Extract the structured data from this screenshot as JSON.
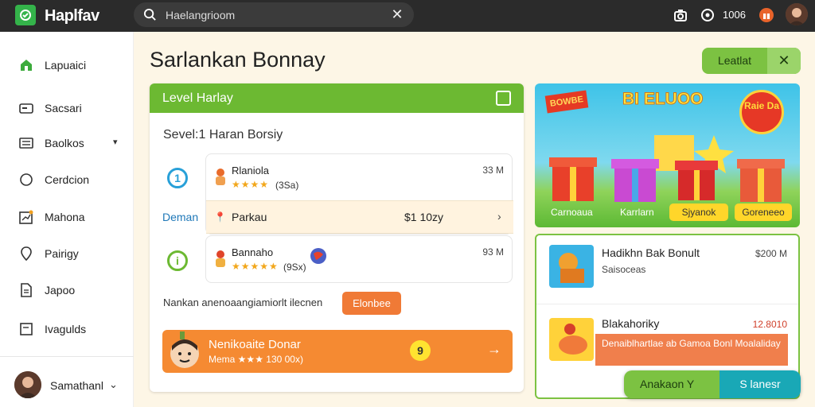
{
  "app": {
    "title": "Haplfav"
  },
  "search": {
    "value": "Haelangrioom",
    "clear_icon": "close-icon"
  },
  "topbar": {
    "count": "1006"
  },
  "sidebar": {
    "items": [
      {
        "label": "Lapuaici",
        "icon": "home-icon",
        "active": true
      },
      {
        "label": "Sacsari",
        "icon": "card-icon"
      },
      {
        "label": "Baolkos",
        "icon": "list-icon",
        "has_submenu": true
      },
      {
        "label": "Cerdcion",
        "icon": "circle-icon"
      },
      {
        "label": "Mahona",
        "icon": "chart-icon"
      },
      {
        "label": "Pairigy",
        "icon": "pin-icon"
      },
      {
        "label": "Japoo",
        "icon": "document-icon"
      },
      {
        "label": "Ivagulds",
        "icon": "box-icon"
      }
    ],
    "user": {
      "name": "Samathanl"
    }
  },
  "main": {
    "title": "Sarlankan Bonnay",
    "top_action_label": "Leatlat",
    "panel": {
      "title": "Level Harlay",
      "subtitle": "Sevel:1 Haran Borsiy",
      "side_label": "Deman",
      "offers": [
        {
          "name": "Rlaniola",
          "stars": "★★★★",
          "reviews": "(3Sa)",
          "price": "33 M",
          "step": "1"
        },
        {
          "name": "Bannaho",
          "stars": "★★★★★",
          "reviews": "(9Sx)",
          "price": "93 M",
          "step": "i"
        }
      ],
      "offer_detail": {
        "label": "Parkau",
        "value": "$1 10zy"
      },
      "note": "Nankan anenoaangiamiorlt ilecnen",
      "note_button": "Elonbee",
      "promo": {
        "title": "Nenikoaite Donar",
        "subtitle": "Mema ★★★ 130 00x)",
        "badge": "9"
      }
    }
  },
  "hero": {
    "title": "BI ELUOO",
    "tag": "BOWBE",
    "burst": "Raie Da",
    "labels": [
      "Carnoaua",
      "Karrlarn"
    ],
    "pills": [
      "Sjyanok",
      "Goreneeo"
    ]
  },
  "list": {
    "items": [
      {
        "name": "Hadikhn Bak Bonult",
        "sub": "Saisoceas",
        "price": "$200 M"
      },
      {
        "name": "Blakahoriky",
        "sub": "Denaiblhartlae ab Gamoa Bonl Moalaliday",
        "price": "12.8010"
      }
    ]
  },
  "float_actions": {
    "left": "Anakaon Y",
    "right": "S lanesr"
  },
  "colors": {
    "accent_green": "#6cb932",
    "accent_orange": "#f58a32",
    "teal": "#19a8b6",
    "topbar": "#2b2b2b"
  }
}
